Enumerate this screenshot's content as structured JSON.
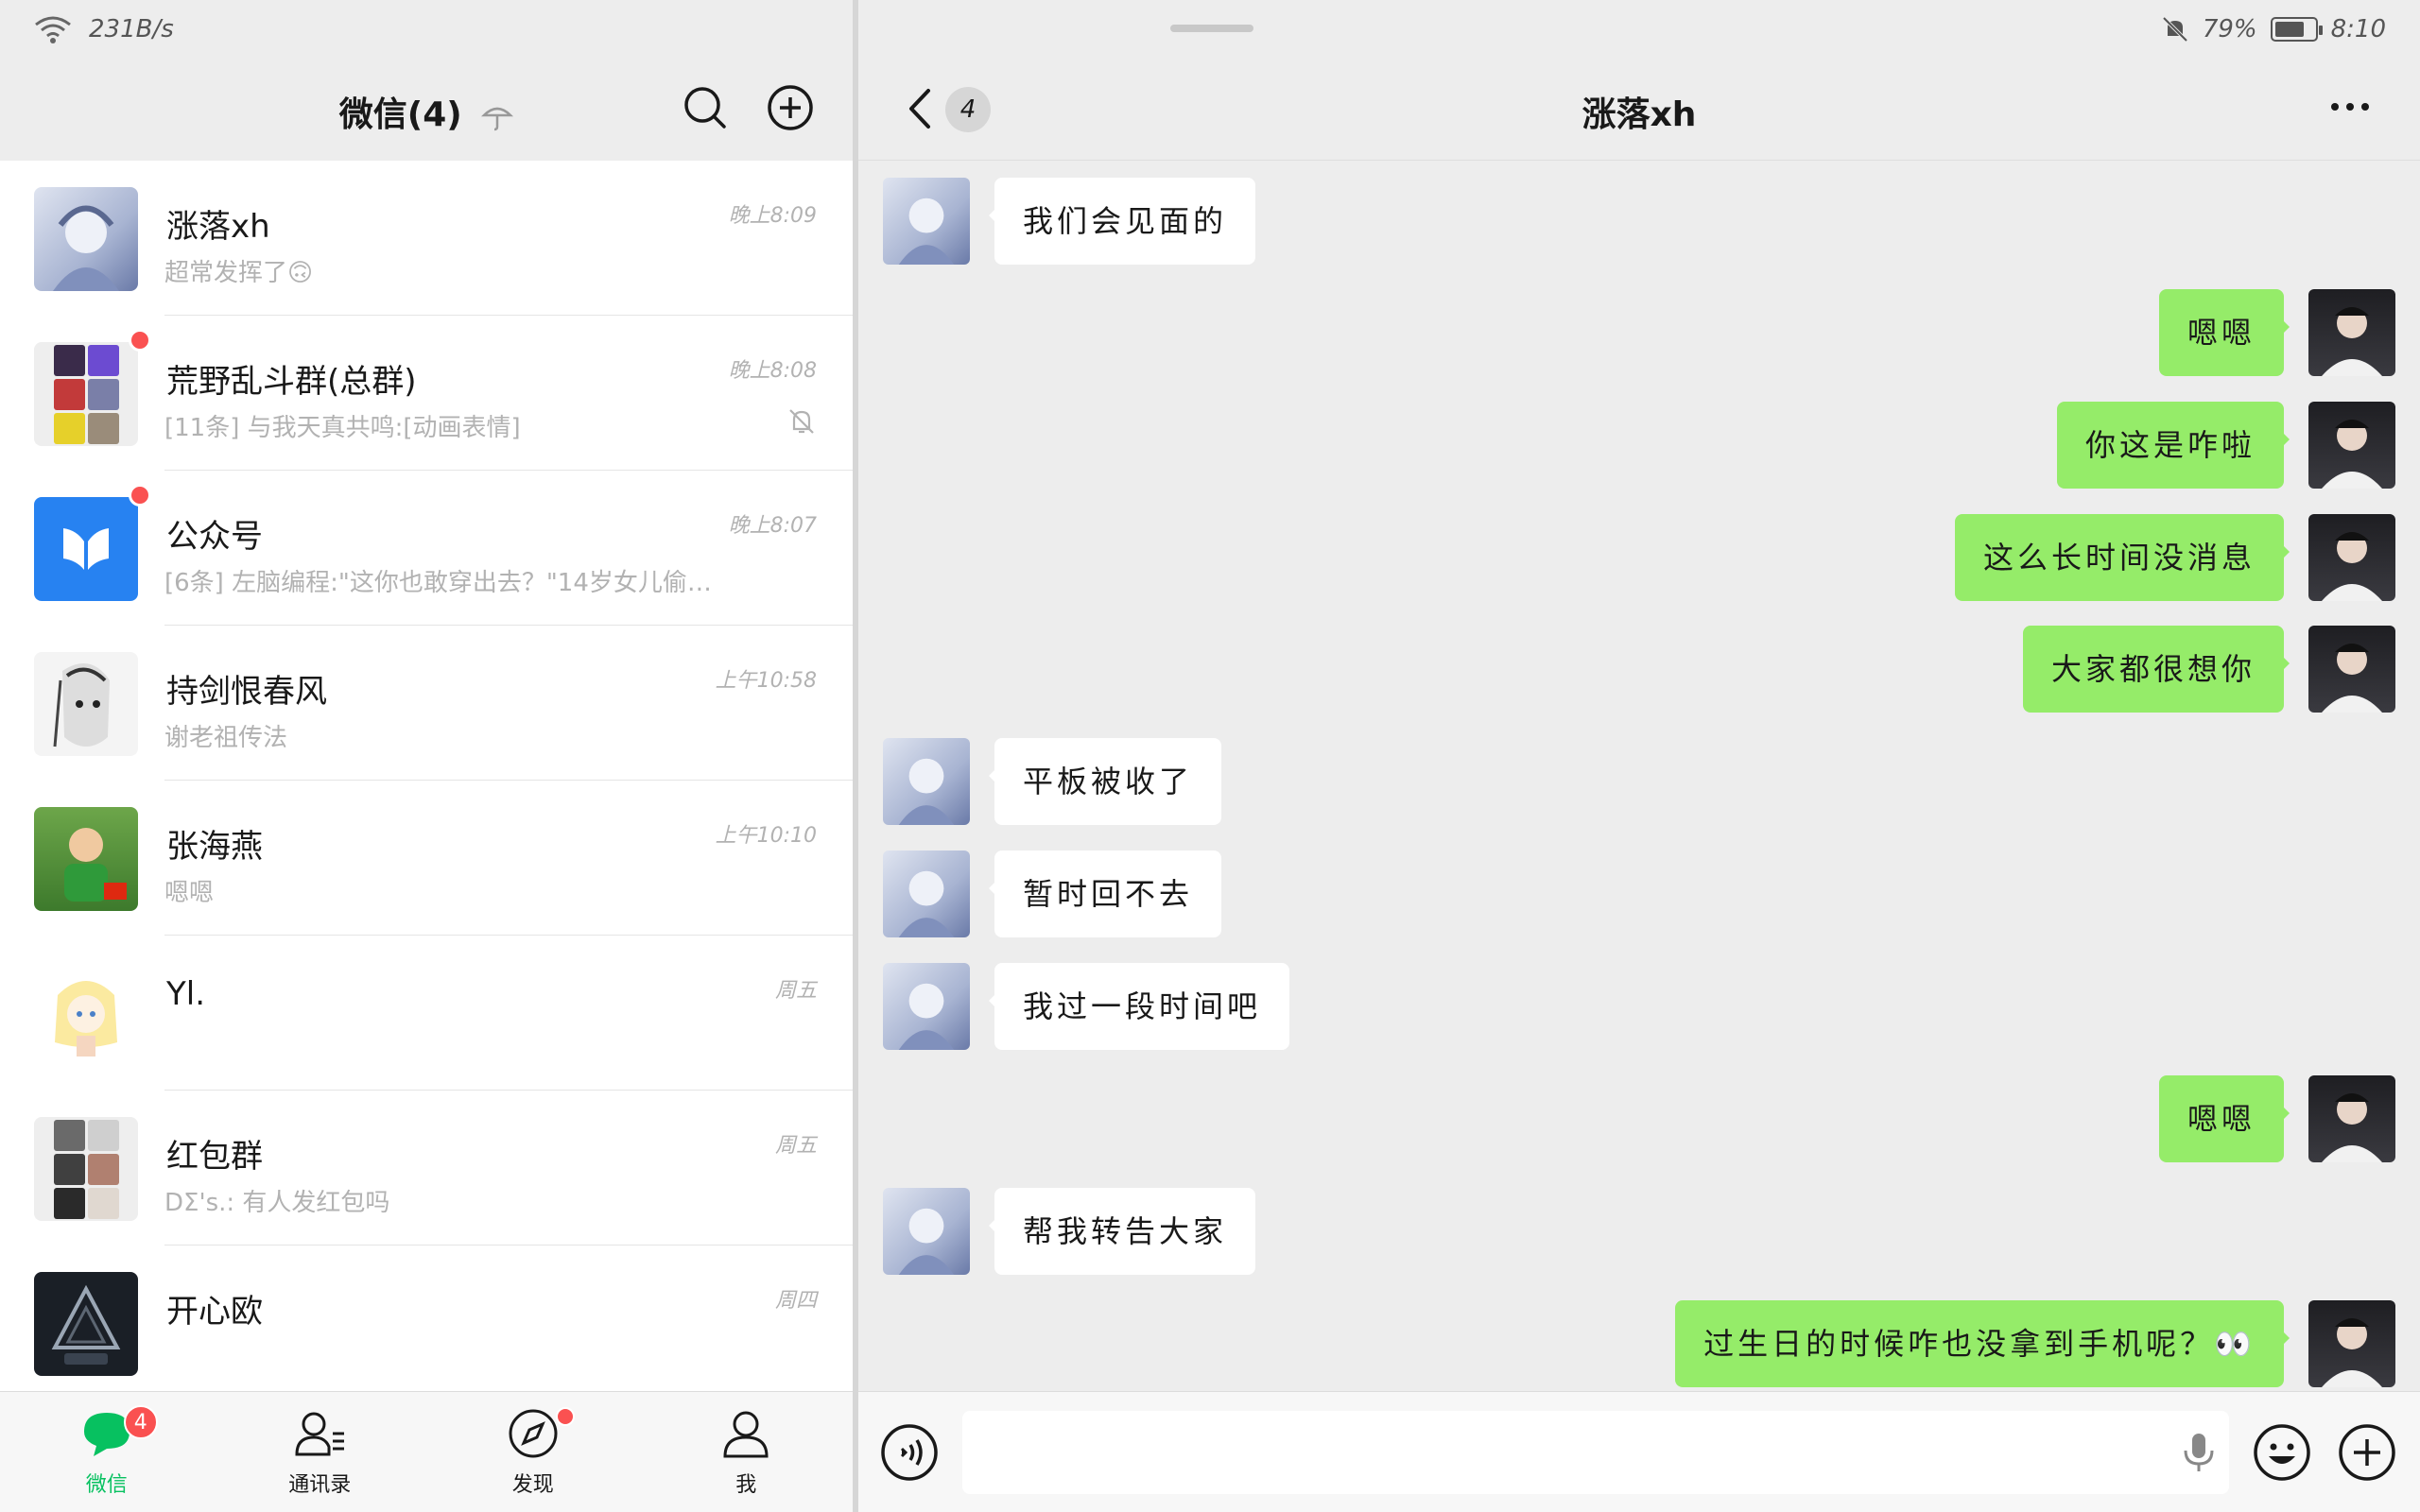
{
  "status_left": {
    "net_speed": "231B/s"
  },
  "status_right": {
    "battery": "79%",
    "time": "8:10"
  },
  "left_header": {
    "title": "微信(4)"
  },
  "chats": [
    {
      "name": "涨落xh",
      "preview": "超常发挥了🙃",
      "time": "晚上8:09",
      "unread_dot": false,
      "muted": false
    },
    {
      "name": "荒野乱斗群(总群)",
      "preview": "[11条] 与我天真共鸣:[动画表情]",
      "time": "晚上8:08",
      "unread_dot": true,
      "muted": true
    },
    {
      "name": "公众号",
      "preview": "[6条] 左脑编程:\"这你也敢穿出去？\"14岁女儿偷…",
      "time": "晚上8:07",
      "unread_dot": true,
      "muted": false
    },
    {
      "name": "持剑恨春风",
      "preview": "谢老祖传法",
      "time": "上午10:58",
      "unread_dot": false,
      "muted": false
    },
    {
      "name": "张海燕",
      "preview": "嗯嗯",
      "time": "上午10:10",
      "unread_dot": false,
      "muted": false
    },
    {
      "name": "Yl.",
      "preview": "",
      "time": "周五",
      "unread_dot": false,
      "muted": false
    },
    {
      "name": "红包群",
      "preview": "DΣ's.: 有人发红包吗",
      "time": "周五",
      "unread_dot": false,
      "muted": false
    },
    {
      "name": "开心欧",
      "preview": "",
      "time": "周四",
      "unread_dot": false,
      "muted": false
    }
  ],
  "tabs": [
    {
      "label": "微信",
      "badge": "4",
      "active": true
    },
    {
      "label": "通讯录",
      "badge": "",
      "active": false
    },
    {
      "label": "发现",
      "badge": "",
      "active": false
    },
    {
      "label": "我",
      "badge": "",
      "active": false
    }
  ],
  "conversation": {
    "title": "涨落xh",
    "back_badge": "4",
    "messages": [
      {
        "from": "in",
        "text": "我们会见面的"
      },
      {
        "from": "out",
        "text": "嗯嗯"
      },
      {
        "from": "out",
        "text": "你这是咋啦"
      },
      {
        "from": "out",
        "text": "这么长时间没消息"
      },
      {
        "from": "out",
        "text": "大家都很想你"
      },
      {
        "from": "in",
        "text": "平板被收了"
      },
      {
        "from": "in",
        "text": "暂时回不去"
      },
      {
        "from": "in",
        "text": "我过一段时间吧"
      },
      {
        "from": "out",
        "text": "嗯嗯"
      },
      {
        "from": "in",
        "text": "帮我转告大家"
      },
      {
        "from": "out",
        "text": "过生日的时候咋也没拿到手机呢？👀"
      }
    ],
    "input_value": ""
  },
  "colors": {
    "accent": "#07c160",
    "bubble_out": "#95ec69",
    "badge": "#fa5151"
  }
}
